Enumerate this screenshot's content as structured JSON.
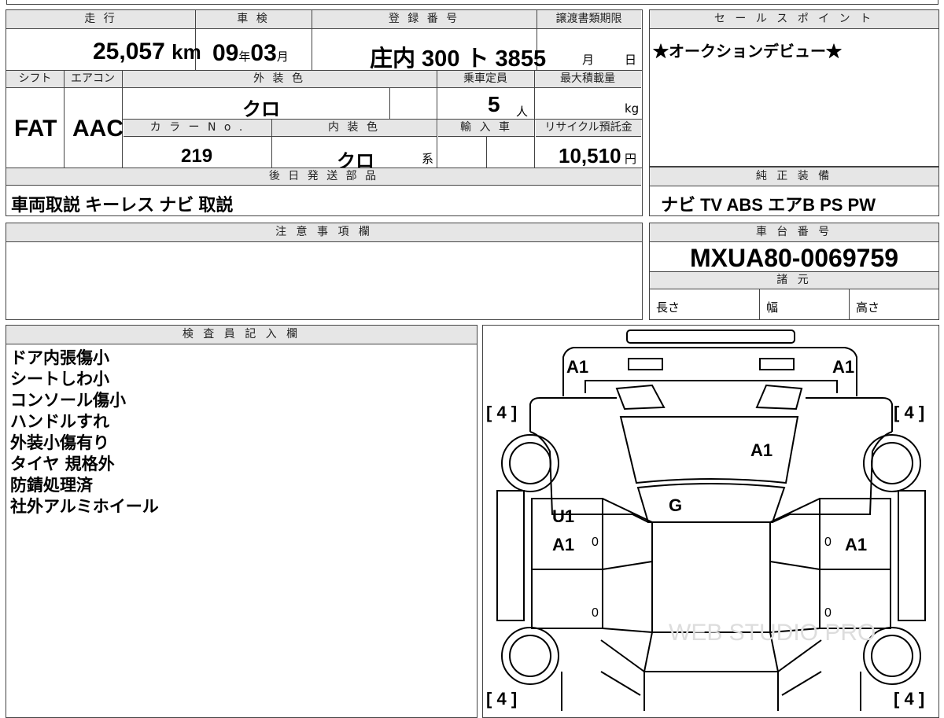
{
  "top_strip": "",
  "main": {
    "mileage_label": "走 行",
    "mileage_value": "25,057",
    "mileage_unit": "km",
    "inspection_label": "車 検",
    "inspection_year": "09",
    "inspection_year_unit": "年",
    "inspection_month": "03",
    "inspection_month_unit": "月",
    "registration_label": "登 録 番 号",
    "registration_value": "庄内 300 ト 3855",
    "transfer_label": "譲渡書類期限",
    "transfer_month_unit": "月",
    "transfer_day_unit": "日",
    "shift_label": "シフト",
    "shift_value": "FAT",
    "ac_label": "エアコン",
    "ac_value": "AAC",
    "exterior_color_label": "外 装 色",
    "exterior_color_value": "クロ",
    "capacity_label": "乗車定員",
    "capacity_value": "5",
    "capacity_unit": "人",
    "max_load_label": "最大積載量",
    "max_load_unit": "kg",
    "color_no_label": "カ ラ ー N o .",
    "color_no_value": "219",
    "interior_color_label": "内 装 色",
    "interior_color_value": "クロ",
    "interior_color_suffix": "系",
    "import_label": "輸 入 車",
    "recycle_label": "リサイクル預託金",
    "recycle_value": "10,510",
    "recycle_unit": "円",
    "accessories_label": "後 日 発 送 部 品",
    "accessories_value": "車両取説 キーレス ナビ 取説"
  },
  "sales_point": {
    "label": "セ ー ル ス ポ イ ン ト",
    "text": "★オークションデビュー★"
  },
  "genuine_equipment": {
    "label": "純 正 装 備",
    "text": "ナビ TV ABS エアB PS PW"
  },
  "notes": {
    "label": "注 意 事 項 欄",
    "text": ""
  },
  "chassis": {
    "label": "車 台 番 号",
    "value": "MXUA80-0069759"
  },
  "specs": {
    "label": "諸 元",
    "length": "長さ",
    "width": "幅",
    "height": "高さ"
  },
  "inspector": {
    "label": "検 査 員 記 入 欄",
    "lines": [
      "ドア内張傷小",
      "シートしわ小",
      "コンソール傷小",
      "ハンドルすれ",
      "外装小傷有り",
      "タイヤ 規格外",
      "防錆処理済",
      "社外アルミホイール"
    ]
  },
  "diagram": {
    "marks": {
      "front_left": "A1",
      "front_right": "A1",
      "hood": "A1",
      "windshield": "G",
      "left_front_door_1": "U1",
      "left_front_door_2": "A1",
      "right_front_door": "A1",
      "zero": "0"
    },
    "tire_tread": "4",
    "watermark": "WEB STUDIO PRO"
  }
}
